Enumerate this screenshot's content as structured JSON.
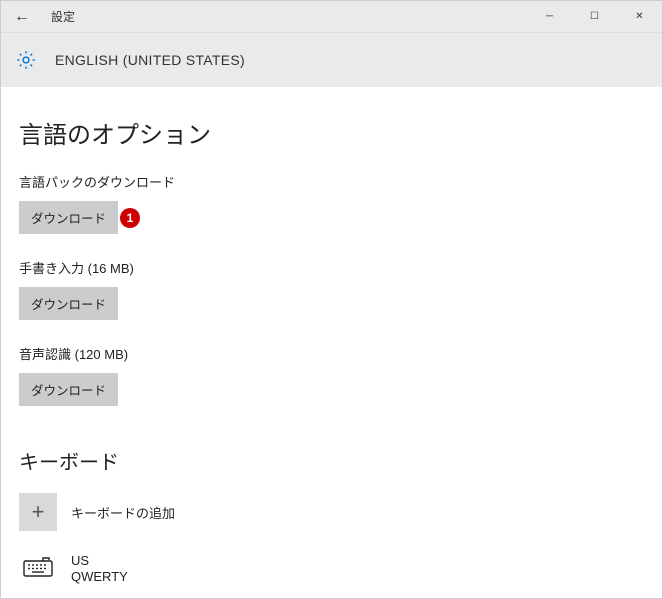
{
  "titlebar": {
    "back_glyph": "←",
    "title": "設定",
    "minimize_glyph": "─",
    "maximize_glyph": "☐",
    "close_glyph": "✕"
  },
  "crumb": {
    "label": "ENGLISH (UNITED STATES)"
  },
  "page": {
    "title": "言語のオプション"
  },
  "lang_pack": {
    "label": "言語パックのダウンロード",
    "button": "ダウンロード",
    "badge": "1"
  },
  "handwriting": {
    "label": "手書き入力 (16 MB)",
    "button": "ダウンロード"
  },
  "speech": {
    "label": "音声認識 (120 MB)",
    "button": "ダウンロード"
  },
  "keyboard": {
    "heading": "キーボード",
    "add_glyph": "+",
    "add_label": "キーボードの追加",
    "item": {
      "line1": "US",
      "line2": "QWERTY"
    }
  }
}
